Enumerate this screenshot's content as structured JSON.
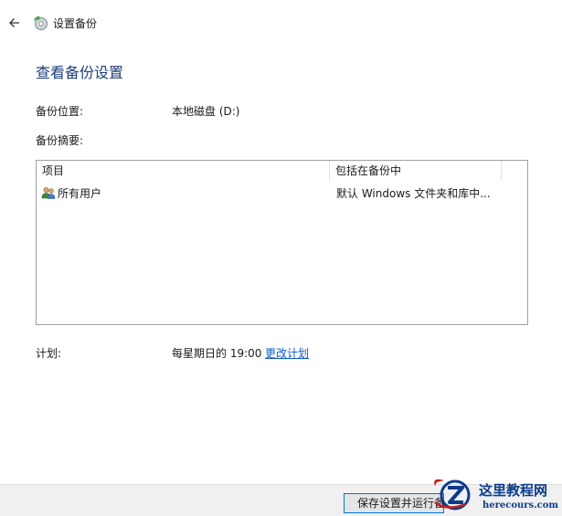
{
  "window": {
    "title": "设置备份"
  },
  "page": {
    "title": "查看备份设置"
  },
  "backup_location": {
    "label": "备份位置:",
    "value": "本地磁盘 (D:)"
  },
  "backup_summary": {
    "label": "备份摘要:",
    "columns": [
      "项目",
      "包括在备份中"
    ],
    "rows": [
      {
        "name": "所有用户",
        "included": "默认 Windows 文件夹和库中...",
        "icon": "users-icon"
      }
    ]
  },
  "schedule": {
    "label": "计划:",
    "value": "每星期日的 19:00",
    "change_link": "更改计划"
  },
  "footer": {
    "save_button": "保存设置并运行备份"
  },
  "watermark": {
    "title": "这里教程网",
    "url": "herecours.com"
  },
  "colors": {
    "accent": "#1e3f7a",
    "link": "#0c5cc4",
    "button_border": "#0078d7",
    "watermark": "#0c3c8c"
  }
}
